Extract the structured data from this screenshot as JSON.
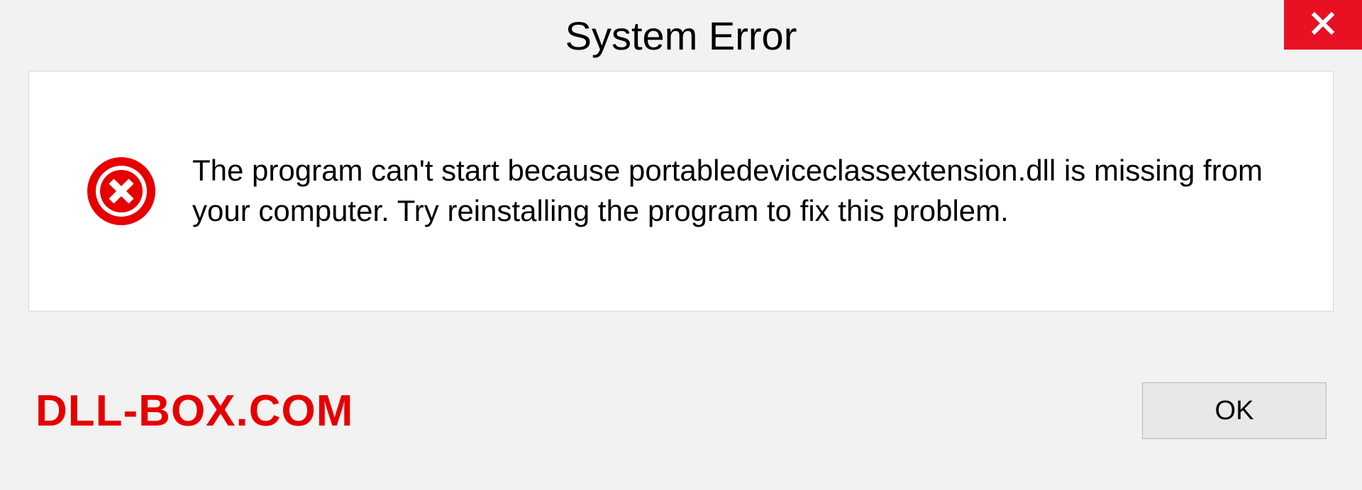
{
  "dialog": {
    "title": "System Error",
    "message": "The program can't start because portabledeviceclassextension.dll is missing from your computer. Try reinstalling the program to fix this problem.",
    "ok_label": "OK"
  },
  "watermark": "DLL-BOX.COM",
  "colors": {
    "close_button": "#e81123",
    "error_icon": "#e60000",
    "watermark": "#e60000"
  }
}
